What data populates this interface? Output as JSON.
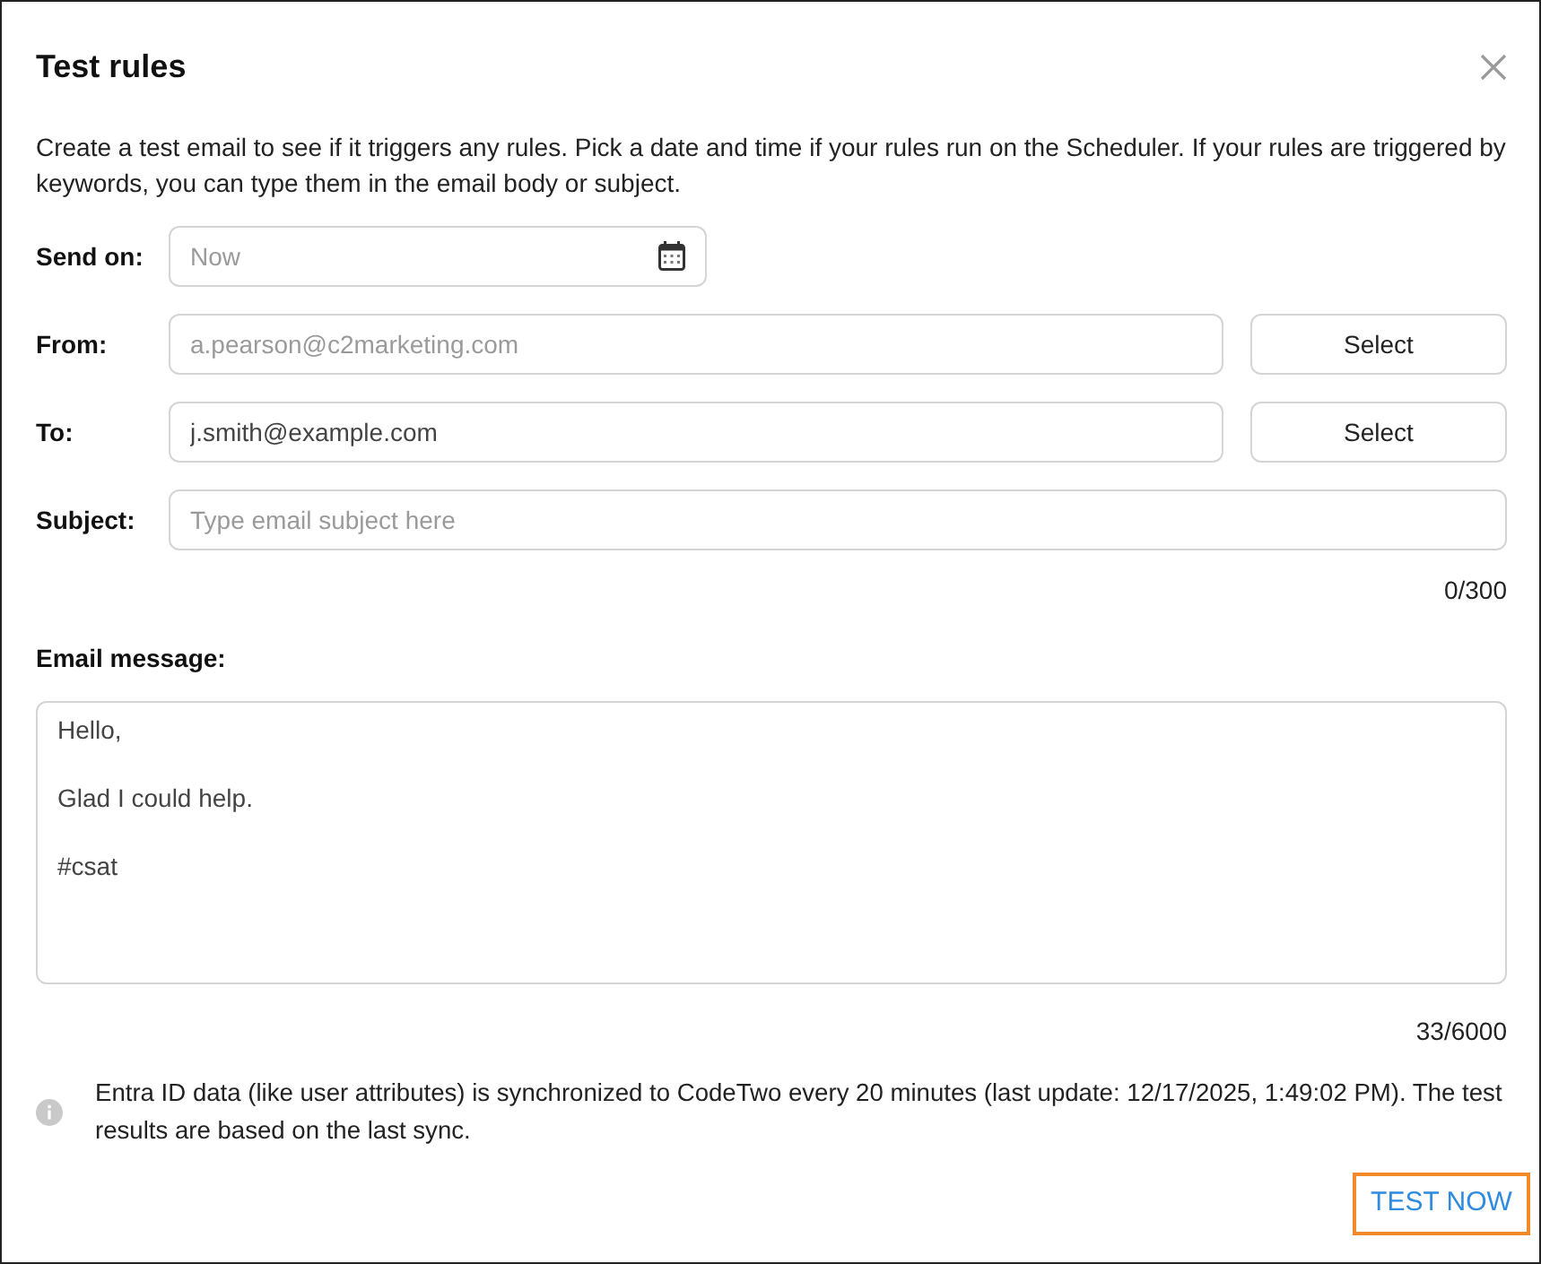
{
  "dialog": {
    "title": "Test rules",
    "description": "Create a test email to see if it triggers any rules. Pick a date and time if your rules run on the Scheduler. If your rules are triggered by keywords, you can type them in the email body or subject."
  },
  "fields": [
    {
      "kind": "date",
      "label": "Send on:",
      "placeholder": "Now"
    },
    {
      "kind": "address",
      "label": "From:",
      "placeholder": "a.pearson@c2marketing.com",
      "button": "Select"
    },
    {
      "kind": "address",
      "label": "To:",
      "value": "j.smith@example.com",
      "button": "Select"
    },
    {
      "kind": "text",
      "label": "Subject:",
      "placeholder": "Type email subject here",
      "counter": "0/300"
    }
  ],
  "message": {
    "label": "Email message:",
    "value": "Hello,\n\nGlad I could help.\n\n#csat",
    "counter": "33/6000"
  },
  "info_note": "Entra ID data (like user attributes) is synchronized to CodeTwo every 20 minutes (last update: 12/17/2025, 1:49:02 PM). The test results are based on the last sync.",
  "buttons": [
    {
      "label": "TEST NOW",
      "focused": true
    }
  ]
}
